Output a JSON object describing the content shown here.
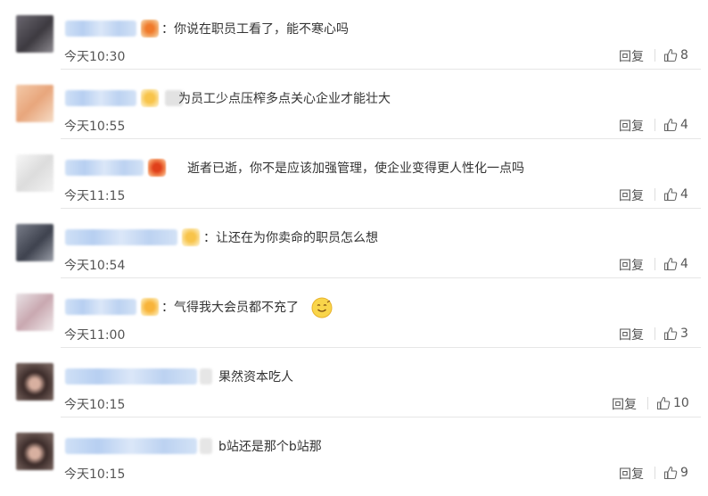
{
  "comments": [
    {
      "text": "：你说在职员工看了，能不寒心吗",
      "time": "今天10:30",
      "reply": "回复",
      "likes": "8"
    },
    {
      "text": "为员工少点压榨多点关心企业才能壮大",
      "time": "今天10:55",
      "reply": "回复",
      "likes": "4"
    },
    {
      "text": "逝者已逝，你不是应该加强管理，使企业变得更人性化一点吗",
      "time": "今天11:15",
      "reply": "回复",
      "likes": "4"
    },
    {
      "text": "：让还在为你卖命的职员怎么想",
      "time": "今天10:54",
      "reply": "回复",
      "likes": "4"
    },
    {
      "text": "：气得我大会员都不充了",
      "time": "今天11:00",
      "reply": "回复",
      "likes": "3"
    },
    {
      "text": "果然资本吃人",
      "time": "今天10:15",
      "reply": "回复",
      "likes": "10"
    },
    {
      "text": "b站还是那个b站那",
      "time": "今天10:15",
      "reply": "回复",
      "likes": "9"
    }
  ],
  "icons": {
    "like": "thumbs-up-icon",
    "badge": "member-badge-icon",
    "emoji": "crying-laugh-emoji-icon"
  },
  "colors": {
    "divider": "#e6e6e6",
    "text": "#333333",
    "meta": "#555555",
    "username_blur": "#bcd2f1"
  }
}
